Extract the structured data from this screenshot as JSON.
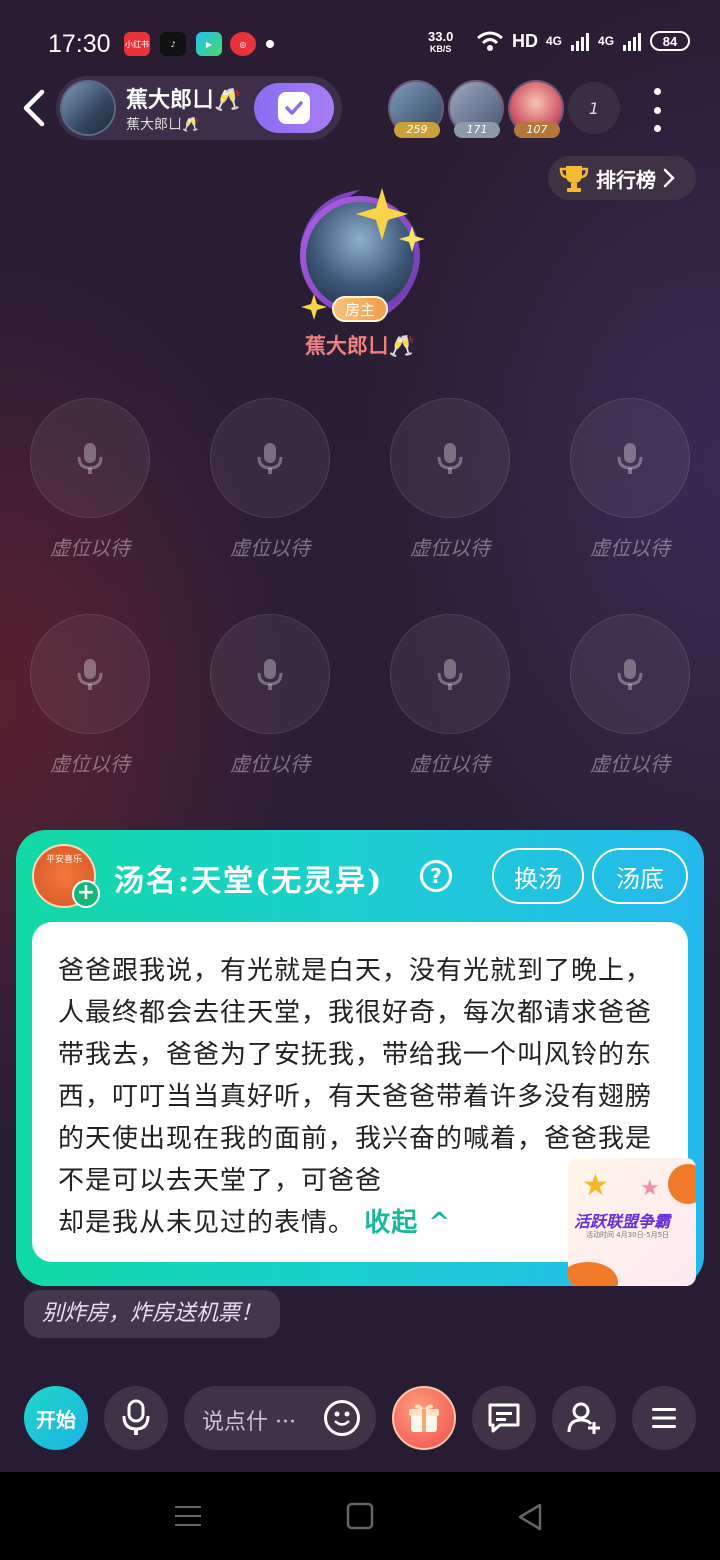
{
  "status_bar": {
    "time": "17:30",
    "apps": [
      "小红书",
      "douyin",
      "video",
      "netease"
    ],
    "net_speed_value": "33.0",
    "net_speed_unit": "KB/S",
    "network": "HD",
    "signal1": "4G",
    "signal2": "4G",
    "battery": "84"
  },
  "header": {
    "room_name": "蕉大郎ㄩ🥂",
    "room_sub": "蕉大郎ㄩ🥂",
    "viewers": [
      {
        "badge": "259",
        "badge_color": "#c9a03a"
      },
      {
        "badge": "171",
        "badge_color": "#8c9aa8"
      },
      {
        "badge": "107",
        "badge_color": "#b4773a"
      }
    ],
    "viewer_count": "1"
  },
  "rank": {
    "label": "排行榜"
  },
  "host": {
    "badge": "房主",
    "name": "蕉大郎ㄩ🥂"
  },
  "seats": [
    {
      "label": "虚位以待"
    },
    {
      "label": "虚位以待"
    },
    {
      "label": "虚位以待"
    },
    {
      "label": "虚位以待"
    },
    {
      "label": "虚位以待"
    },
    {
      "label": "虚位以待"
    },
    {
      "label": "虚位以待"
    },
    {
      "label": "虚位以待"
    }
  ],
  "game": {
    "avatar_text": "平安喜乐",
    "title": "汤名:天堂(无灵异)",
    "help": "?",
    "swap_label": "换汤",
    "answer_label": "汤底",
    "story": "爸爸跟我说，有光就是白天，没有光就到了晚上，人最终都会去往天堂，我很好奇，每次都请求爸爸带我去，爸爸为了安抚我，带给我一个叫风铃的东西，叮叮当当真好听，有天爸爸带着许多没有翅膀的天使出现在我的面前，我兴奋的喊着，爸爸我是不是可以去天堂了，可爸爸",
    "story_end": "却是我从未见过的表情。",
    "collapse": "收起 ^",
    "promo_title": "活跃联盟争霸",
    "promo_sub": "活动时间 4月30日-5月5日"
  },
  "chat": {
    "message": "别炸房，炸房送机票！"
  },
  "toolbar": {
    "start": "开始",
    "input_placeholder": "说点什 ···"
  }
}
